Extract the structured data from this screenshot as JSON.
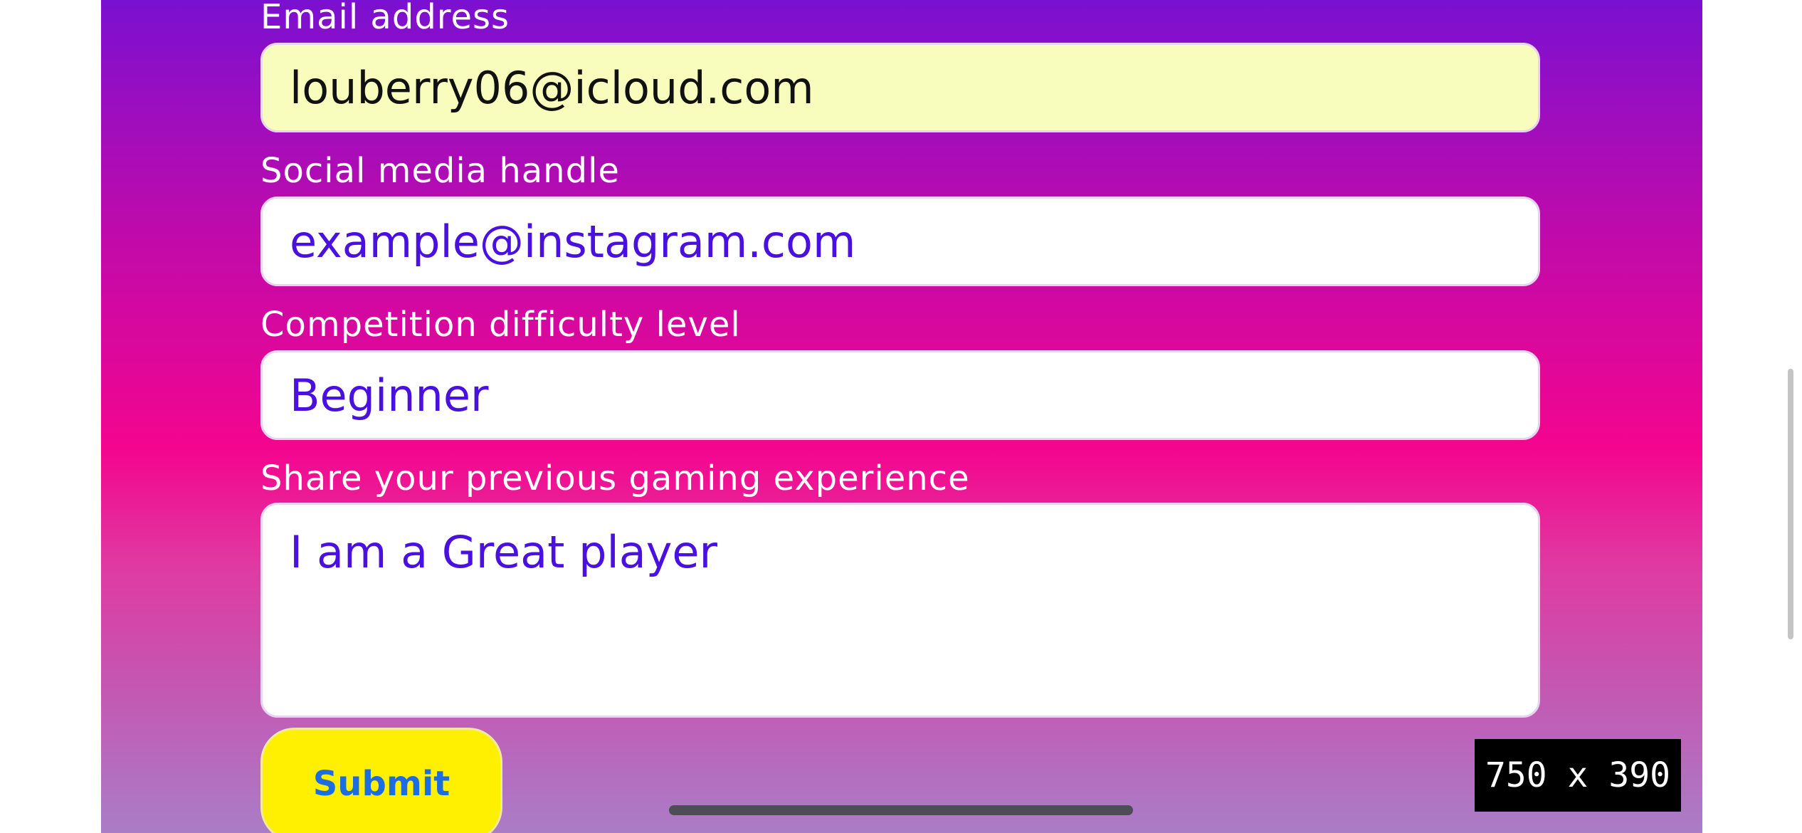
{
  "form": {
    "email": {
      "label": "Email address",
      "value": "louberry06@icloud.com"
    },
    "social": {
      "label": "Social media handle",
      "value": "example@instagram.com"
    },
    "difficulty": {
      "label": "Competition difficulty level",
      "value": "Beginner"
    },
    "experience": {
      "label": "Share your previous gaming experience",
      "value": "I am a Great player"
    },
    "submit_label": "Submit"
  },
  "overlay": {
    "size_badge": "750 x 390"
  },
  "colors": {
    "gradient_top": "#7a10d0",
    "gradient_mid": "#f4058e",
    "gradient_bottom": "#aa7dc6",
    "input_text": "#4a10e0",
    "autofill_bg": "#f8fdbd",
    "submit_bg": "#ffef00",
    "submit_text": "#1c6ee0"
  }
}
